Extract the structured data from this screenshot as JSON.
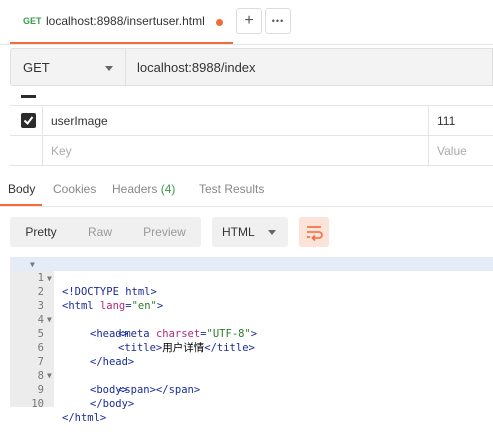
{
  "tab": {
    "method": "GET",
    "title": "localhost:8988/insertuser.html",
    "add_label": "+",
    "more_label": "•••"
  },
  "request": {
    "method": "GET",
    "url": "localhost:8988/index"
  },
  "params": [
    {
      "checked": true,
      "key": "userImage",
      "value": "111"
    }
  ],
  "params_placeholders": {
    "key": "Key",
    "value": "Value"
  },
  "response_tabs": {
    "body": "Body",
    "cookies": "Cookies",
    "headers": "Headers",
    "headers_count": "(4)",
    "test_results": "Test Results"
  },
  "view": {
    "pretty": "Pretty",
    "raw": "Raw",
    "preview": "Preview",
    "format": "HTML"
  },
  "code_lines": [
    "1",
    "2",
    "3",
    "4",
    "5",
    "6",
    "7",
    "8",
    "9",
    "10"
  ],
  "code": {
    "l1": "<!DOCTYPE html>",
    "l2a": "<html ",
    "l2b": "lang",
    "l2c": "=",
    "l2d": "\"en\"",
    "l2e": ">",
    "l3": "<head>",
    "l4a": "<meta ",
    "l4b": "charset",
    "l4c": "=",
    "l4d": "\"UTF-8\"",
    "l4e": ">",
    "l5a": "<title>",
    "l5b": "用户详情",
    "l5c": "</title>",
    "l6": "</head>",
    "l7": "<body>",
    "l8": "<span></span>",
    "l9": "</body>",
    "l10": "</html>"
  },
  "colors": {
    "accent": "#f26b3a",
    "get_method": "#3b9b4f",
    "headers_count": "#3b9b4f"
  }
}
